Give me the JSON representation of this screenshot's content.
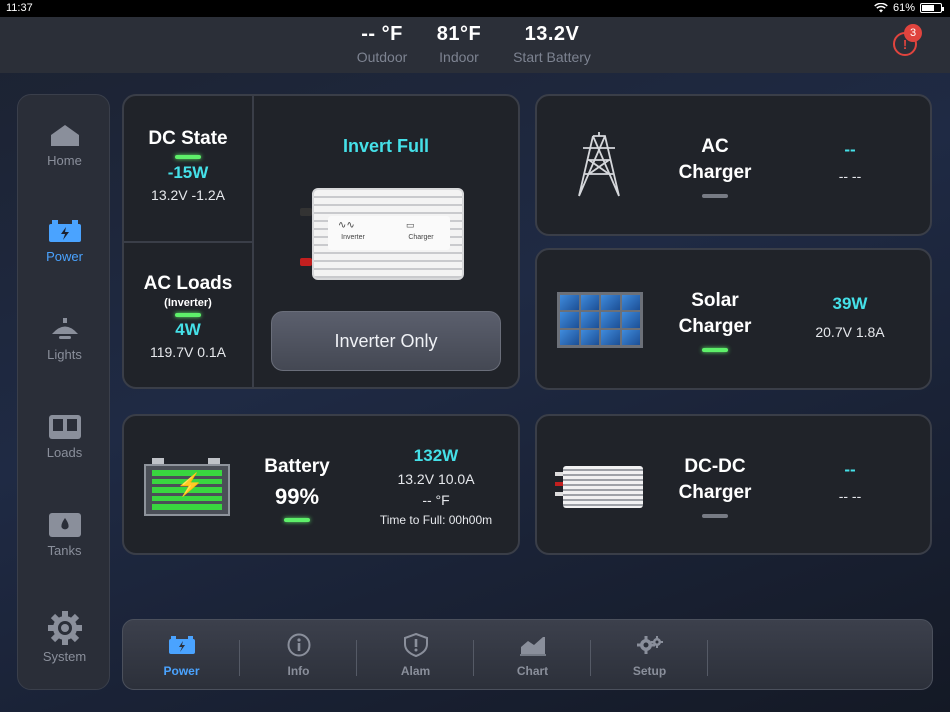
{
  "statusbar": {
    "time": "11:37",
    "battery": "61%",
    "battery_level": 0.61
  },
  "readouts": [
    {
      "value": "-- °F",
      "label": "Outdoor"
    },
    {
      "value": "81°F",
      "label": "Indoor"
    },
    {
      "value": "13.2V",
      "label": "Start Battery"
    }
  ],
  "alerts": {
    "count": "3",
    "icon": "!"
  },
  "sidebar": [
    {
      "label": "Home",
      "icon": "home-icon",
      "active": false
    },
    {
      "label": "Power",
      "icon": "battery-icon",
      "active": true
    },
    {
      "label": "Lights",
      "icon": "light-icon",
      "active": false
    },
    {
      "label": "Loads",
      "icon": "loads-icon",
      "active": false
    },
    {
      "label": "Tanks",
      "icon": "tank-icon",
      "active": false
    },
    {
      "label": "System",
      "icon": "gear-icon",
      "active": false
    }
  ],
  "dc_state": {
    "title": "DC State",
    "power": "-15W",
    "detail": "13.2V -1.2A",
    "indicator": "on"
  },
  "ac_loads": {
    "title": "AC Loads",
    "subtitle": "(Inverter)",
    "power": "4W",
    "detail": "119.7V 0.1A",
    "indicator": "on"
  },
  "inverter": {
    "status": "Invert Full",
    "label_inverter": "Inverter",
    "label_charger": "Charger",
    "mode_button": "Inverter Only"
  },
  "ac_charger": {
    "title_line1": "AC",
    "title_line2": "Charger",
    "power": "--",
    "detail": "-- --",
    "indicator": "off"
  },
  "solar_charger": {
    "title_line1": "Solar",
    "title_line2": "Charger",
    "power": "39W",
    "detail": "20.7V  1.8A",
    "indicator": "on"
  },
  "battery": {
    "title": "Battery",
    "soc": "99%",
    "power": "132W",
    "detail": "13.2V  10.0A",
    "temp": "-- °F",
    "time_to_full": "Time to Full:  00h00m",
    "indicator": "on"
  },
  "dcdc_charger": {
    "title_line1": "DC-DC",
    "title_line2": "Charger",
    "power": "--",
    "detail": "-- --",
    "indicator": "off"
  },
  "tabs": [
    {
      "label": "Power",
      "icon": "battery-icon",
      "active": true
    },
    {
      "label": "Info",
      "icon": "info-icon",
      "active": false
    },
    {
      "label": "Alam",
      "icon": "shield-icon",
      "active": false
    },
    {
      "label": "Chart",
      "icon": "chart-icon",
      "active": false
    },
    {
      "label": "Setup",
      "icon": "gears-icon",
      "active": false
    }
  ],
  "colors": {
    "accent": "#4aa3ff",
    "value_cyan": "#45e0e8",
    "indicator_green": "#5ef06a",
    "alert_red": "#e0443e"
  }
}
